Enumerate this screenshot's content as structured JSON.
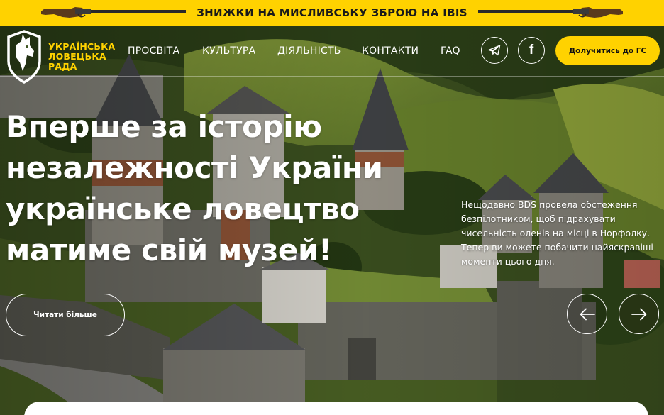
{
  "promo": {
    "text": "ЗНИЖКИ НА МИСЛИВСЬКУ ЗБРОЮ НА IBIS",
    "left_icon": "shotgun-icon",
    "right_icon": "shotgun-icon"
  },
  "logo": {
    "icon": "dog-shield-logo",
    "lines": [
      "УКРАЇНСЬКА",
      "ЛОВЕЦЬКА",
      "РАДА"
    ]
  },
  "nav": {
    "items": [
      {
        "label": "ПРОСВІТА"
      },
      {
        "label": "КУЛЬТУРА"
      },
      {
        "label": "ДІЯЛЬНІСТЬ"
      },
      {
        "label": "КОНТАКТИ"
      },
      {
        "label": "FAQ"
      }
    ]
  },
  "social": {
    "telegram_icon": "telegram-icon",
    "facebook_glyph": "f"
  },
  "cta": {
    "join_label": "Долучитись до ГС"
  },
  "hero": {
    "headline_lines": [
      "Вперше за історію",
      "незалежності України",
      "українське ловецтво",
      "матиме свій музей!"
    ],
    "description": "Нещодавно BDS провела обстеження безпілотником, щоб підрахувати чисельність оленів на місці в Норфолку. Тепер ви можете побачити найяскравіші моменти цього дня.",
    "read_more_label": "Читати більше",
    "prev_icon": "arrow-left-icon",
    "next_icon": "arrow-right-icon"
  },
  "colors": {
    "accent": "#ffd200",
    "text_on_hero": "#ffffff"
  }
}
